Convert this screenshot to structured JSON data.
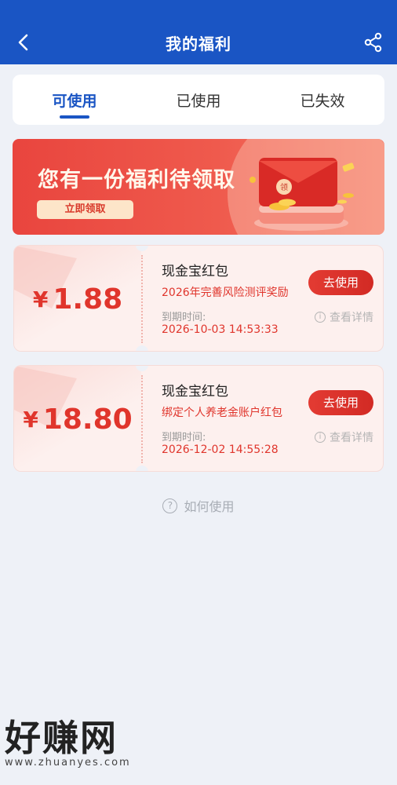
{
  "header": {
    "title": "我的福利",
    "back_icon": "chevron-left-icon",
    "share_icon": "share-icon"
  },
  "tabs": [
    {
      "label": "可使用",
      "active": true
    },
    {
      "label": "已使用",
      "active": false
    },
    {
      "label": "已失效",
      "active": false
    }
  ],
  "banner": {
    "title": "您有一份福利待领取",
    "button_label": "立即领取",
    "envelope_char": "领"
  },
  "coupons": [
    {
      "currency": "¥",
      "amount": "1.88",
      "title": "现金宝红包",
      "desc": "2026年完善风险测评奖励",
      "expire_label": "到期时间:",
      "expire_date": "2026-10-03 14:53:33",
      "use_label": "去使用",
      "detail_label": "查看详情"
    },
    {
      "currency": "¥",
      "amount": "18.80",
      "title": "现金宝红包",
      "desc": "绑定个人养老金账户红包",
      "expire_label": "到期时间:",
      "expire_date": "2026-12-02 14:55:28",
      "use_label": "去使用",
      "detail_label": "查看详情"
    }
  ],
  "howto": {
    "label": "如何使用",
    "icon_char": "?"
  },
  "watermark": {
    "text": "好赚网",
    "url": "www.zhuanyes.com"
  },
  "colors": {
    "brand_blue": "#1a55c4",
    "accent_red": "#e0352c"
  }
}
